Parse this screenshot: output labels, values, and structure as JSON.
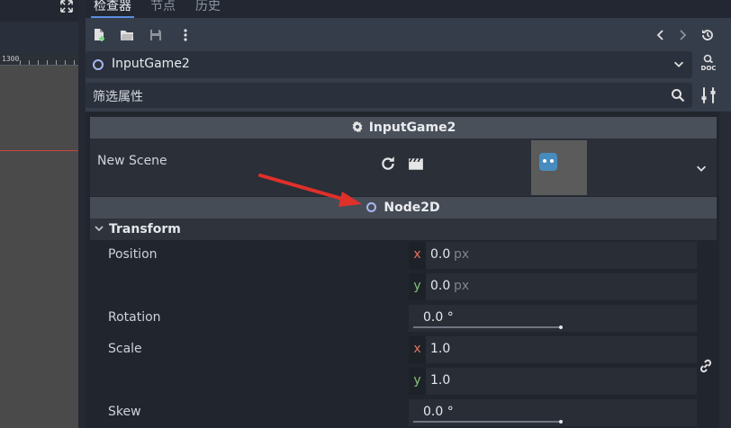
{
  "viewport": {
    "ruler_label": "1300"
  },
  "dock": {
    "tabs": [
      {
        "label": "检查器",
        "active": true
      },
      {
        "label": "节点",
        "active": false
      },
      {
        "label": "历史",
        "active": false
      }
    ]
  },
  "toolbar": {
    "icons": [
      "new-resource-icon",
      "open-folder-icon",
      "save-icon",
      "more-vertical-icon",
      "history-back-icon",
      "history-forward-icon",
      "object-history-icon"
    ]
  },
  "object_picker": {
    "label": "InputGame2",
    "doc_label": "DOC"
  },
  "filter": {
    "placeholder": "筛选属性"
  },
  "resource": {
    "header": "InputGame2",
    "scene_label": "New Scene"
  },
  "node": {
    "header": "Node2D",
    "section": "Transform",
    "position_label": "Position",
    "position_x": "0.0",
    "position_y": "0.0",
    "position_unit": "px",
    "rotation_label": "Rotation",
    "rotation_value": "0.0 °",
    "scale_label": "Scale",
    "scale_x": "1.0",
    "scale_y": "1.0",
    "skew_label": "Skew",
    "skew_value": "0.0 °",
    "axis_x": "x",
    "axis_y": "y"
  },
  "colors": {
    "accent": "#5a8de0",
    "axis_x": "#e4715f",
    "axis_y": "#84c27a",
    "node_ring": "#a7b8f0",
    "annotation_arrow": "#e0302a"
  }
}
